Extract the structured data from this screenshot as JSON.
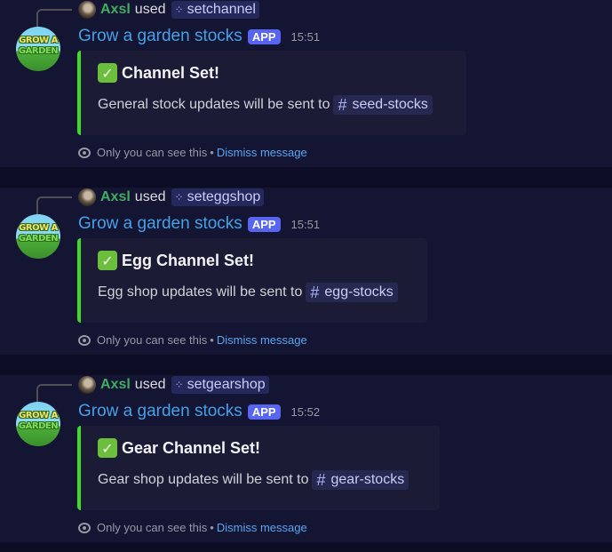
{
  "messages": [
    {
      "reply_user": "Axsl",
      "reply_used": "used",
      "command": "setchannel",
      "bot_name": "Grow a garden stocks",
      "app_tag": "APP",
      "time": "15:51",
      "embed_title": "Channel Set!",
      "embed_desc": "General stock updates will be sent to",
      "channel": "seed-stocks",
      "footer_only": "Only you can see this",
      "footer_sep": "•",
      "footer_dismiss": "Dismiss message"
    },
    {
      "reply_user": "Axsl",
      "reply_used": "used",
      "command": "seteggshop",
      "bot_name": "Grow a garden stocks",
      "app_tag": "APP",
      "time": "15:51",
      "embed_title": "Egg Channel Set!",
      "embed_desc": "Egg shop updates will be sent to",
      "channel": "egg-stocks",
      "footer_only": "Only you can see this",
      "footer_sep": "•",
      "footer_dismiss": "Dismiss message"
    },
    {
      "reply_user": "Axsl",
      "reply_used": "used",
      "command": "setgearshop",
      "bot_name": "Grow a garden stocks",
      "app_tag": "APP",
      "time": "15:52",
      "embed_title": "Gear Channel Set!",
      "embed_desc": "Gear shop updates will be sent to",
      "channel": "gear-stocks",
      "footer_only": "Only you can see this",
      "footer_sep": "•",
      "footer_dismiss": "Dismiss message"
    }
  ],
  "avatar_logo": {
    "line1": "GROW A",
    "line2": "GARDEN"
  },
  "icons": {
    "command": "slash-command-icon",
    "check": "white-check-mark-icon",
    "channel": "hash-channel-icon",
    "eye": "eye-icon"
  },
  "colors": {
    "background": "#0c0c24",
    "message_bg": "#141433",
    "embed_bg": "#1b1b35",
    "embed_accent": "#3bdc2c",
    "bot_name": "#46a0e6",
    "app_tag": "#5865f2",
    "username": "#3fae5e",
    "link": "#5aa6ee"
  }
}
